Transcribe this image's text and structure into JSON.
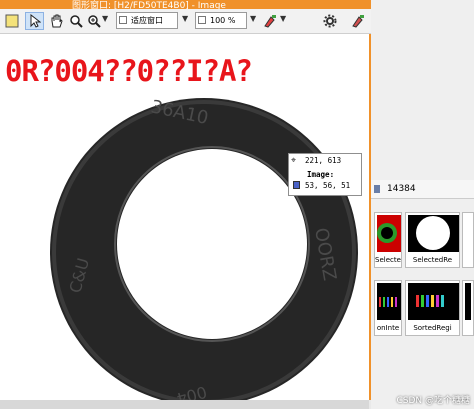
{
  "window": {
    "title": "图形窗口: [H2/FD50TE4B0] - Image"
  },
  "toolbar": {
    "fit_label": "适应窗口",
    "zoom_label": "100 %"
  },
  "overlay": {
    "text": "0R?004??0??I?A?"
  },
  "part": {
    "engraving_top": "36A10",
    "engraving_right": "OORZ",
    "engraving_left": "C&U",
    "engraving_bottom": "004"
  },
  "tooltip": {
    "coords": "221, 613",
    "heading": "Image:",
    "value": "53, 56, 51",
    "swatch_color": "#4b63c8"
  },
  "right_panel": {
    "info": "14384",
    "thumbnails": [
      {
        "label": "SelectedR"
      },
      {
        "label": "SelectedRe"
      },
      {
        "label": "onInte"
      },
      {
        "label": "SortedRegi"
      }
    ]
  },
  "watermark": "CSDN @吃个糖糖",
  "colors": {
    "title_orange": "#f0912a",
    "overlay_red": "#e8151b"
  }
}
